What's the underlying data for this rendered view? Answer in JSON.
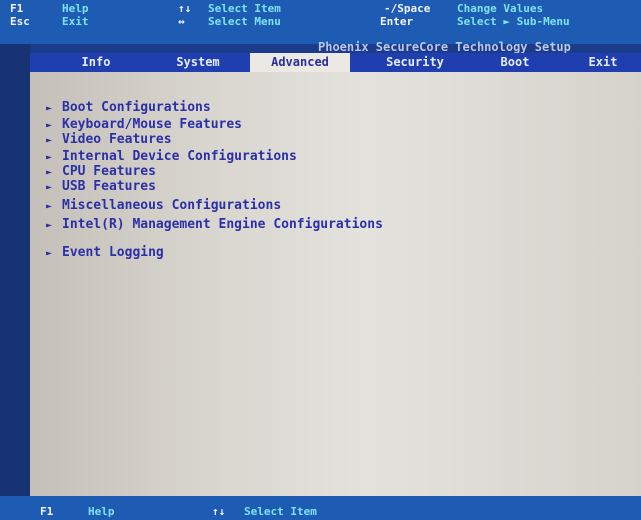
{
  "top_legend": [
    {
      "key": "F1",
      "desc": "Help"
    },
    {
      "key": "Esc",
      "desc": "Exit"
    },
    {
      "key": "↑↓",
      "desc": "Select Item"
    },
    {
      "key": "↔",
      "desc": "Select Menu"
    },
    {
      "key": "-/Space",
      "desc": "Change Values"
    },
    {
      "key": "Enter",
      "desc": "Select ► Sub-Menu"
    }
  ],
  "title": "Phoenix SecureCore Technology Setup",
  "tabs": [
    "Info",
    "System",
    "Advanced",
    "Security",
    "Boot",
    "Exit"
  ],
  "active_tab": "Advanced",
  "menu_items": [
    "Boot Configurations",
    "Keyboard/Mouse Features",
    "Video Features",
    "Internal Device Configurations",
    "CPU Features",
    "USB Features",
    "Miscellaneous Configurations",
    "Intel(R) Management Engine Configurations",
    "Event Logging"
  ],
  "arrow_glyph": "►",
  "bottom_legend": [
    {
      "key": "F1",
      "desc": "Help"
    },
    {
      "key": "↑↓",
      "desc": "Select Item"
    }
  ],
  "colors": {
    "legend_bg": "#1e5cb4",
    "tab_bar": "#1f3fb0",
    "panel": "#e4e2dd",
    "menu_text": "#2c30a8"
  }
}
